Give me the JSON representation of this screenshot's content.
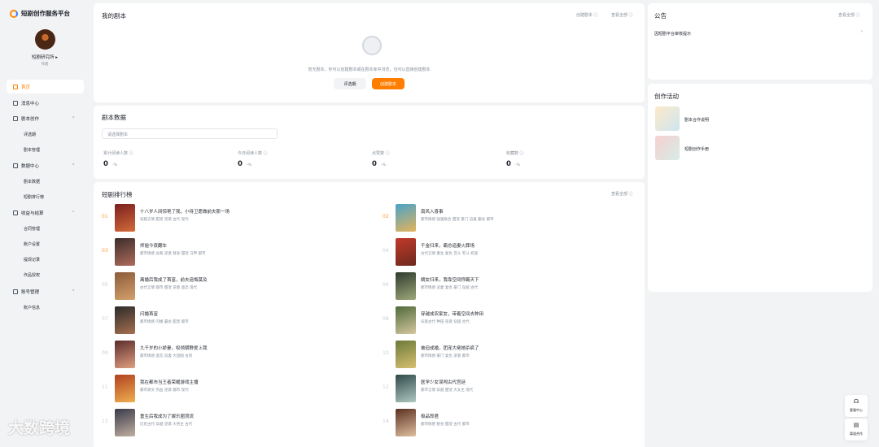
{
  "brand": {
    "name": "短剧创作服务平台"
  },
  "user": {
    "name": "短剧研究所 ▸",
    "role": "作者"
  },
  "nav": {
    "home": "首页",
    "message": "消息中心",
    "script_create": "剧本创作",
    "script_create_sub": [
      "评选期",
      "剧本管理"
    ],
    "data": "数据中心",
    "data_sub": [
      "剧本数据",
      "短剧排行榜"
    ],
    "earn": "收益与结算",
    "earn_sub": [
      "合同管理",
      "账户设置",
      "提现记录",
      "作品授权"
    ],
    "account": "账号管理",
    "account_sub": [
      "账户信息"
    ]
  },
  "my_script": {
    "title": "我的剧本",
    "create_link": "创建剧本 ⓘ",
    "view_all": "查看全部 ⓘ",
    "empty": "暂无剧本，你可以创建剧本或在剧本库中浏览，也可以直接创建剧本",
    "btn_secondary": "评选期",
    "btn_primary": "创建剧本"
  },
  "script_data": {
    "title": "剧本数据",
    "select_placeholder": "请选择剧本",
    "stats": [
      {
        "label": "累计阅读人数 ⓘ",
        "value": "0",
        "unit": "-%"
      },
      {
        "label": "今日阅读人数 ⓘ",
        "value": "0",
        "unit": "-%"
      },
      {
        "label": "点赞数 ⓘ",
        "value": "0",
        "unit": "-%"
      },
      {
        "label": "收藏数 ⓘ",
        "value": "0",
        "unit": "-%"
      }
    ]
  },
  "ranking": {
    "title": "短剧排行榜",
    "more": "查看全部 ⓘ",
    "items": [
      {
        "num": "01",
        "title": "十八岁人间惊艳了我，小侍卫愿做前夫那一场",
        "tags": "穿越言情 甜宠 逆袭 古代 现代"
      },
      {
        "num": "02",
        "title": "南风入喜事",
        "tags": "都市情感 强强联合 甜宠 豪门 追妻 霸总 都市"
      },
      {
        "num": "03",
        "title": "师姐今夜翻车",
        "tags": "都市情感 总裁 逆袭 替身 甜宠 马甲 都市"
      },
      {
        "num": "04",
        "title": "千金归来，霸总追妻火葬场",
        "tags": "古代言情 重生 复仇 宫斗 宅斗 权谋"
      },
      {
        "num": "05",
        "title": "离婚后我成了首富，前夫追悔莫及",
        "tags": "古代言情 都市 甜宠 逆袭 虐恋 现代"
      },
      {
        "num": "06",
        "title": "嫡女归来，我靠空间称霸天下",
        "tags": "都市情感 追妻 复仇 豪门 穿越 古代"
      },
      {
        "num": "07",
        "title": "闪婚首富",
        "tags": "都市情感 闪婚 霸总 甜宠 都市"
      },
      {
        "num": "08",
        "title": "穿越成农家女，带着空间去种田",
        "tags": "农家古代 种田 逆袭 穿越 古代"
      },
      {
        "num": "09",
        "title": "九千岁的小娇妻，权倾朝野爱上我",
        "tags": "都市情感 虐恋 追妻 大团圆 古风"
      },
      {
        "num": "10",
        "title": "被迫成婚，团宠大佬她杀疯了",
        "tags": "都市情感 豪门 复仇 逆袭 都市"
      },
      {
        "num": "11",
        "title": "我在都市当王者荣耀游戏主播",
        "tags": "都市爽文 热血 逆袭 都市 现代"
      },
      {
        "num": "12",
        "title": "医学少女误闯古代宫廷",
        "tags": "都市言情 穿越 甜宠 大女主 现代"
      },
      {
        "num": "13",
        "title": "重生后我成为了娱乐圈顶流",
        "tags": "历史古代 穿越 逆袭 大男主 古代"
      },
      {
        "num": "14",
        "title": "极品郎君",
        "tags": "都市情感 替身 甜宠 古代 都市"
      }
    ]
  },
  "notice": {
    "title": "公告",
    "more": "查看全部 ⓘ",
    "item": "因短剧平台审核提示"
  },
  "activity": {
    "title": "创作活动",
    "items": [
      "剧本合作说明",
      "短剧创作手册"
    ]
  },
  "float": {
    "a": "客服中心",
    "b": "渠道合作"
  },
  "colors": {
    "accent": "#ff7d00",
    "rank_top": "#ff9a2e"
  },
  "watermark": "大数跨境"
}
